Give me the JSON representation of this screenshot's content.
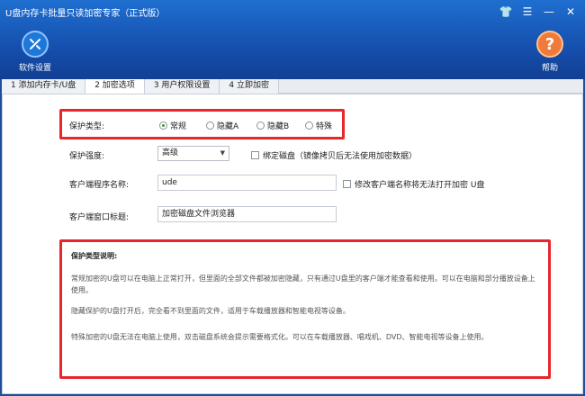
{
  "window": {
    "title": "U盘内存卡批量只读加密专家（正式版）"
  },
  "toolbar": {
    "settings_label": "软件设置",
    "help_label": "帮助"
  },
  "tabs": [
    "1 添加内存卡/U盘",
    "2 加密选项",
    "3 用户权限设置",
    "4 立即加密"
  ],
  "form": {
    "protect_type_label": "保护类型:",
    "protect_options": [
      "常规",
      "隐藏A",
      "隐藏B",
      "特殊"
    ],
    "strength_label": "保护强度:",
    "strength_value": "高级",
    "bind_disk_label": "绑定磁盘（镜像拷贝后无法使用加密数据）",
    "client_name_label": "客户端程序名称:",
    "client_name_value": "ude",
    "modify_client_label": "修改客户端名称将无法打开加密 U盘",
    "window_title_label": "客户端窗口标题:",
    "window_title_value": "加密磁盘文件浏览器"
  },
  "description": {
    "heading": "保护类型说明:",
    "para1": "常规加密的U盘可以在电脑上正常打开，但里面的全部文件都被加密隐藏，只有通过U盘里的客户端才能查看和使用。可以在电脑和部分播放设备上使用。",
    "para2": "隐藏保护的U盘打开后，完全看不到里面的文件，适用于车载播放器和智能电视等设备。",
    "para3": "特殊加密的U盘无法在电脑上使用，双击磁盘系统会提示需要格式化。可以在车载播放器、唱戏机、DVD、智能电视等设备上使用。"
  },
  "colors": {
    "accent": "#1652b1",
    "highlight": "#e8262b",
    "radio_selected": "#2f9e2f"
  }
}
